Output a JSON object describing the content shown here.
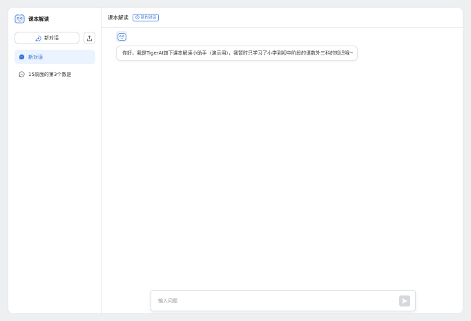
{
  "app": {
    "name": "课本解读",
    "brand_color": "#2f6fd6"
  },
  "sidebar": {
    "new_chat_label": "新对话",
    "conversations": [
      {
        "label": "新对话",
        "active": true
      },
      {
        "label": "15前面的第3个数是",
        "active": false
      }
    ]
  },
  "header": {
    "title": "课本解读",
    "tag_label": "新的对话"
  },
  "chat": {
    "messages": [
      {
        "role": "assistant",
        "text": "你好，我是TigerAI旗下课本解读小助手（演示用），我暂时只学习了小学到初中阶段的语数外三科的知识哦~"
      }
    ]
  },
  "composer": {
    "placeholder": "输入问题",
    "value": ""
  },
  "icons": {
    "brand": "robot-logo-icon",
    "new_chat": "chat-plus-icon",
    "export": "upload-icon",
    "conversation": "chat-bubble-icon",
    "tag": "clock-icon",
    "send": "send-icon"
  }
}
